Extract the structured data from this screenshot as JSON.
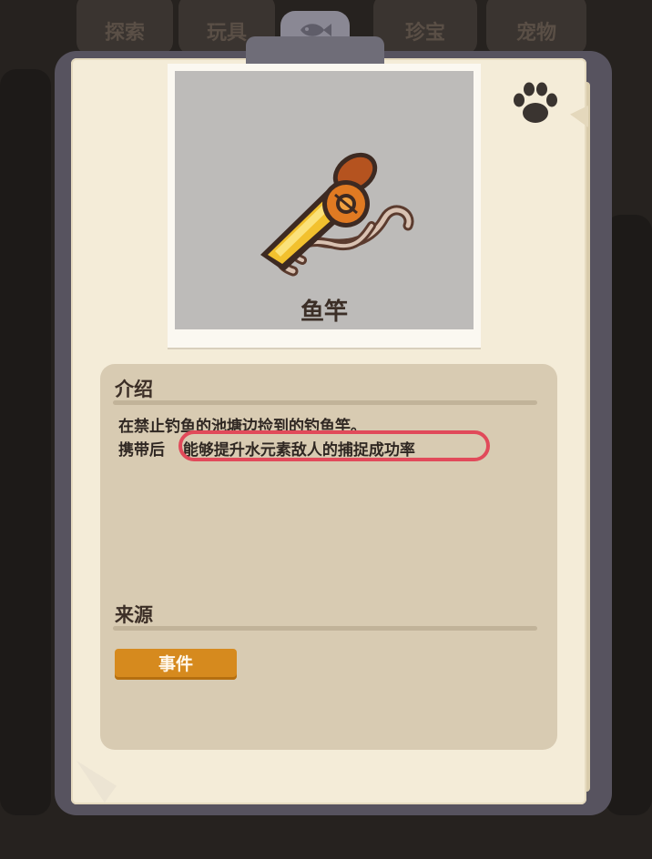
{
  "background_tabs": [
    "探索",
    "玩具",
    "珍宝",
    "宠物"
  ],
  "item": {
    "name": "鱼竿",
    "icon": "fishing-rod-icon"
  },
  "intro": {
    "heading": "介绍",
    "line1": "在禁止钓鱼的池塘边捡到的钓鱼竿。",
    "line2_prefix": "携带后",
    "line2_effect": "能够提升水元素敌人的捕捉成功率"
  },
  "source": {
    "heading": "来源",
    "button_label": "事件"
  },
  "colors": {
    "highlight": "#e14a5a",
    "source_button": "#d68a1e",
    "paper": "#f4ecd8",
    "panel": "#d8cbb2"
  }
}
